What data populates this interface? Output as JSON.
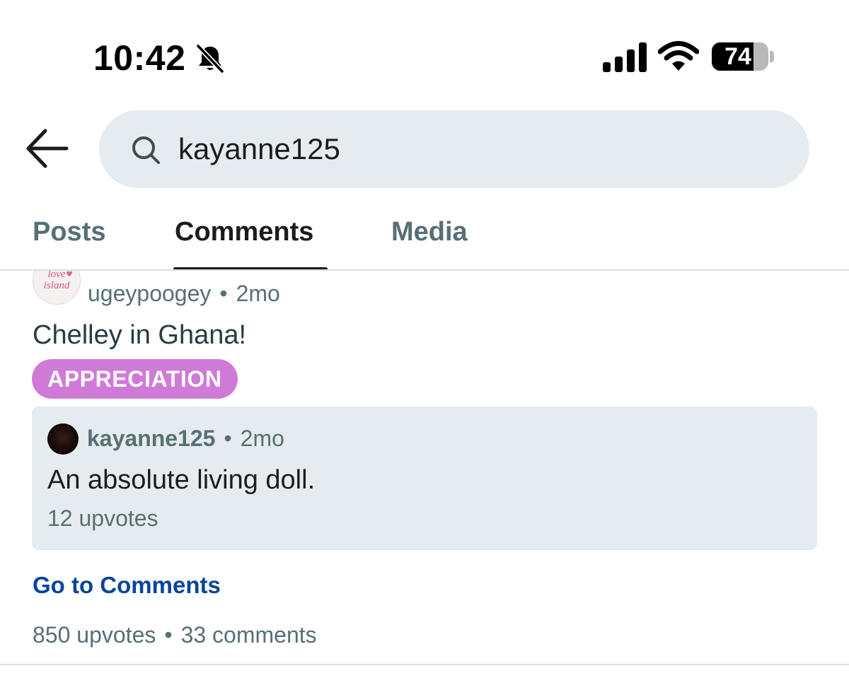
{
  "status_bar": {
    "time": "10:42",
    "battery_percent": "74",
    "battery_level": 0.74,
    "icons": [
      "bell-slash-icon",
      "cellular-signal-icon",
      "wifi-icon",
      "battery-icon"
    ]
  },
  "header": {
    "back_icon": "arrow-left-icon",
    "search_icon": "search-icon",
    "search_value": "kayanne125"
  },
  "tabs": [
    {
      "label": "Posts",
      "active": false
    },
    {
      "label": "Comments",
      "active": true
    },
    {
      "label": "Media",
      "active": false
    }
  ],
  "result": {
    "community_avatar_text": "love island",
    "author": "ugeypoogey",
    "age": "2mo",
    "separator": "•",
    "title": "Chelley in Ghana!",
    "flair": "APPRECIATION",
    "comment": {
      "author": "kayanne125",
      "age": "2mo",
      "body": "An absolute living doll.",
      "upvotes": "12 upvotes"
    },
    "go_to_comments": "Go to Comments",
    "upvotes": "850 upvotes",
    "comments": "33 comments"
  },
  "colors": {
    "accent_link": "#0a449b",
    "flair_bg": "#d07ad8",
    "search_bg": "#e5ebee",
    "muted_text": "#576f76"
  }
}
